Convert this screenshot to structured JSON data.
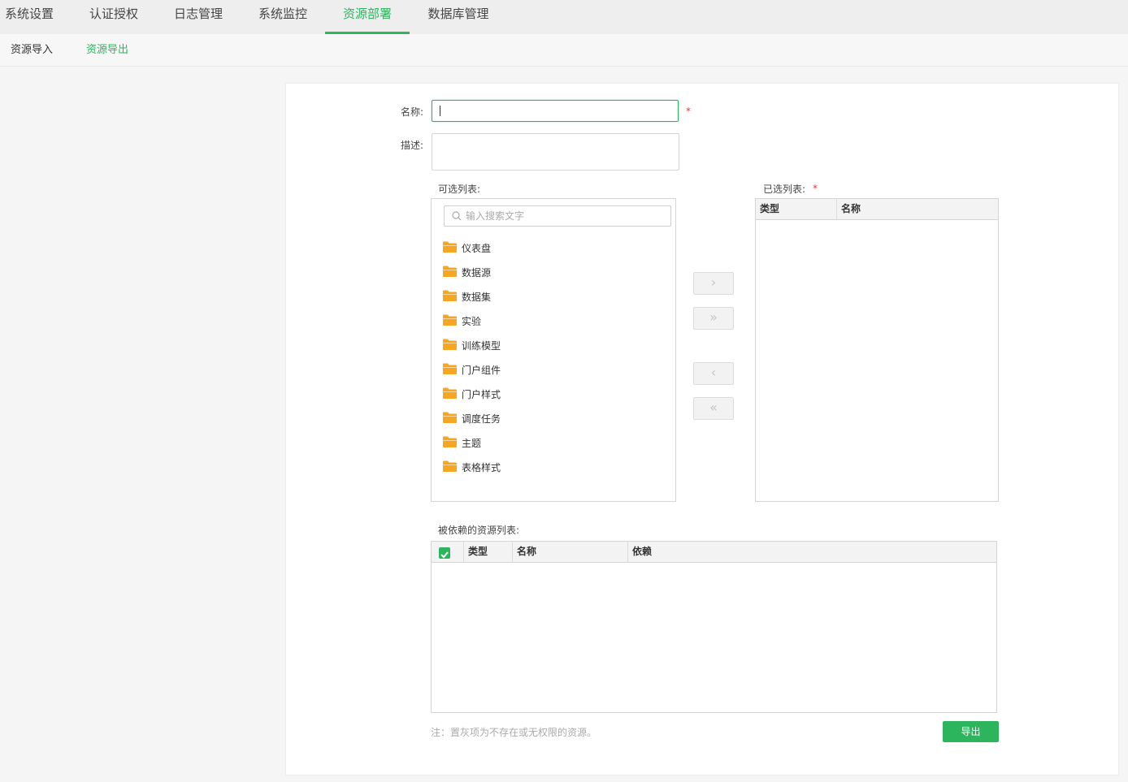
{
  "top_nav": {
    "tabs": [
      {
        "label": "系统设置"
      },
      {
        "label": "认证授权"
      },
      {
        "label": "日志管理"
      },
      {
        "label": "系统监控"
      },
      {
        "label": "资源部署"
      },
      {
        "label": "数据库管理"
      }
    ],
    "active": "资源部署"
  },
  "sub_nav": {
    "items": [
      {
        "label": "资源导入"
      },
      {
        "label": "资源导出"
      }
    ],
    "active": "资源导出"
  },
  "form": {
    "name_label": "名称:",
    "name_value": "",
    "required_mark": "*",
    "desc_label": "描述:",
    "desc_value": ""
  },
  "available": {
    "title": "可选列表:",
    "search_placeholder": "输入搜索文字",
    "items": [
      {
        "label": "仪表盘",
        "icon": "folder-icon"
      },
      {
        "label": "数据源",
        "icon": "folder-icon"
      },
      {
        "label": "数据集",
        "icon": "folder-icon"
      },
      {
        "label": "实验",
        "icon": "folder-icon"
      },
      {
        "label": "训练模型",
        "icon": "folder-icon"
      },
      {
        "label": "门户组件",
        "icon": "folder-icon"
      },
      {
        "label": "门户样式",
        "icon": "folder-icon"
      },
      {
        "label": "调度任务",
        "icon": "folder-icon"
      },
      {
        "label": "主题",
        "icon": "folder-icon"
      },
      {
        "label": "表格样式",
        "icon": "folder-icon"
      }
    ]
  },
  "transfer_buttons": {
    "add": "›",
    "add_all": "»",
    "remove": "‹",
    "remove_all": "«"
  },
  "selected": {
    "title": "已选列表:",
    "required_mark": "*",
    "columns": [
      "类型",
      "名称"
    ],
    "rows": []
  },
  "dependencies": {
    "title": "被依赖的资源列表:",
    "columns": [
      "类型",
      "名称",
      "依赖"
    ],
    "select_all_checked": true,
    "rows": []
  },
  "note": "注：置灰项为不存在或无权限的资源。",
  "export_button": "导出",
  "colors": {
    "accent": "#2db55d",
    "folder": "#f5a623",
    "required": "#e0393e"
  }
}
